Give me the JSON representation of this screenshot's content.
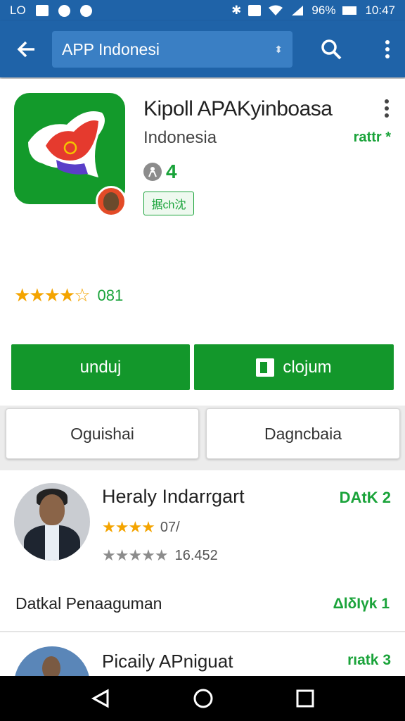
{
  "status_bar": {
    "left_items": [
      "LO",
      "M"
    ],
    "battery": "96%",
    "time": "10:47"
  },
  "app_bar": {
    "search_text": "APP Indonesi"
  },
  "app": {
    "title": "Kipoll APAKyinboasa",
    "developer": "Indonesia",
    "developer_side": "rattr *",
    "age_rating": "4",
    "tag": "据ch沈"
  },
  "rating": {
    "stars": "★★★★☆",
    "count": "081"
  },
  "buttons": {
    "install": "unduj",
    "open": "clojum",
    "secondary_left": "Oguishai",
    "secondary_right": "Dagncbaia"
  },
  "list": [
    {
      "name": "Heraly Indarrgart",
      "badge": "DAtK 2",
      "stars": "★★★★",
      "star_value": "07/",
      "gray_stars": "★★★★★",
      "gray_value": "16.452",
      "detail_label": "Datkal Penaaguman",
      "detail_value": "ΔlδΙγk 1"
    },
    {
      "name": "Picaily APniguat",
      "badge": "rıatk 3"
    }
  ],
  "colors": {
    "primary": "#1f63a8",
    "accent_green": "#13972b",
    "star": "#f4a400"
  }
}
